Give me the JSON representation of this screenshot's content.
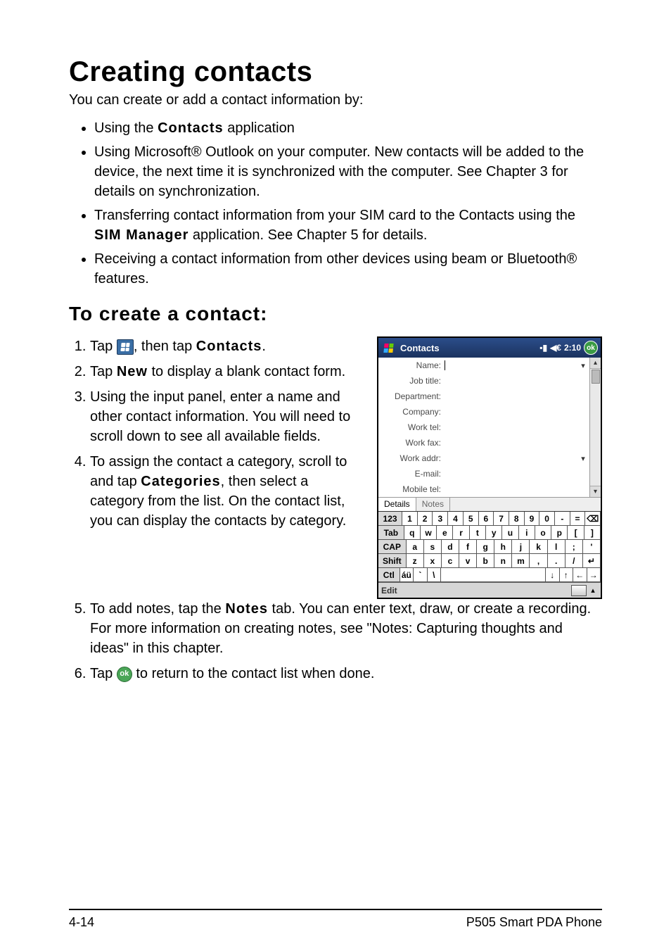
{
  "title": "Creating contacts",
  "intro": "You can create or add a contact information by:",
  "bullets": {
    "b1": {
      "pre": "Using the ",
      "strong": "Contacts",
      "post": " application"
    },
    "b2": "Using Microsoft® Outlook on your computer. New contacts will be added to the device, the next time it is synchronized with the computer. See Chapter 3 for details on synchronization.",
    "b3": {
      "pre": "Transferring contact information from your SIM card to the Contacts using the ",
      "strong": "SIM Manager",
      "post": " application. See Chapter 5 for details."
    },
    "b4": "Receiving a contact information from other devices using beam or Bluetooth® features."
  },
  "subheading": "To create a contact:",
  "steps": {
    "s1a": "Tap ",
    "s1b": ", then tap ",
    "s1c": "Contacts",
    "s1d": ".",
    "s2a": "Tap ",
    "s2b": "New",
    "s2c": " to display a blank contact form.",
    "s3": "Using the input panel, enter a name and other contact information. You will need to scroll down to see all available fields.",
    "s4a": "To assign the contact a category, scroll to and tap ",
    "s4b": "Categories",
    "s4c": ", then select a category from the list. On the contact list, you can display the contacts by category.",
    "s5a": "To add notes, tap the ",
    "s5b": "Notes",
    "s5c": " tab. You can enter text, draw, or create a recording. For more information on creating notes, see \"Notes: Capturing thoughts and ideas\" in this chapter.",
    "s6a": "Tap ",
    "s6b": " to return to the contact list when done."
  },
  "pda": {
    "title": "Contacts",
    "time": "2:10",
    "ok": "ok",
    "signal": "▪▮",
    "speaker": "◀€",
    "fields": [
      "Name:",
      "Job title:",
      "Department:",
      "Company:",
      "Work tel:",
      "Work fax:",
      "Work addr:",
      "E-mail:",
      "Mobile tel:"
    ],
    "tabs": {
      "details": "Details",
      "notes": "Notes"
    },
    "edit": "Edit",
    "kb": {
      "row1": [
        "123",
        "1",
        "2",
        "3",
        "4",
        "5",
        "6",
        "7",
        "8",
        "9",
        "0",
        "-",
        "=",
        "⌫"
      ],
      "row2": [
        "Tab",
        "q",
        "w",
        "e",
        "r",
        "t",
        "y",
        "u",
        "i",
        "o",
        "p",
        "[",
        "]"
      ],
      "row3": [
        "CAP",
        "a",
        "s",
        "d",
        "f",
        "g",
        "h",
        "j",
        "k",
        "l",
        ";",
        "'"
      ],
      "row4": [
        "Shift",
        "z",
        "x",
        "c",
        "v",
        "b",
        "n",
        "m",
        ",",
        ".",
        "/",
        "↵"
      ],
      "row5": [
        "Ctl",
        "áü",
        "`",
        "\\",
        " ",
        "↓",
        "↑",
        "←",
        "→"
      ]
    }
  },
  "footer": {
    "left": "4-14",
    "right": "P505 Smart PDA Phone"
  }
}
